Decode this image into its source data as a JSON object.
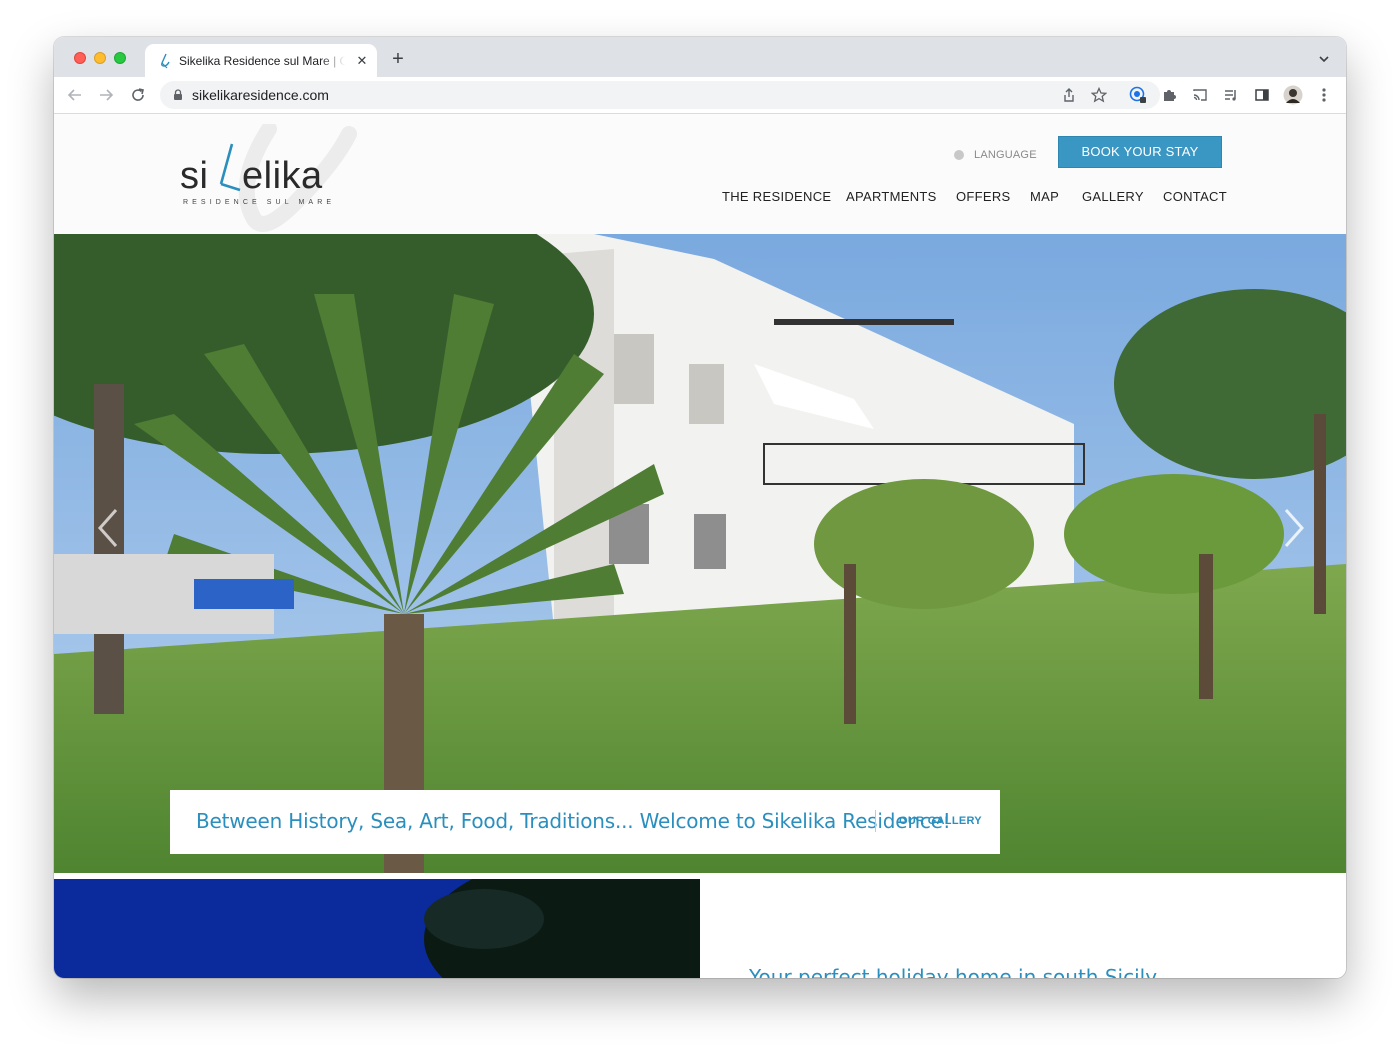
{
  "browser": {
    "tab_title": "Sikelika Residence sul Mare | C",
    "url": "sikelikaresidence.com",
    "new_tab": "+",
    "close_tab": "✕"
  },
  "header": {
    "logo_main": "sikelika",
    "logo_sub": "RESIDENCE SUL MARE",
    "language_label": "LANGUAGE",
    "book_button": "BOOK YOUR STAY",
    "nav": [
      "THE RESIDENCE",
      "APARTMENTS",
      "OFFERS",
      "MAP",
      "GALLERY",
      "CONTACT"
    ]
  },
  "hero": {
    "caption": "Between History, Sea, Art, Food, Traditions... Welcome to Sikelika Residence!",
    "caption_link": "OUR GALLERY"
  },
  "section": {
    "heading": "Your perfect holiday home in south Sicily"
  },
  "colors": {
    "accent": "#2a8fbe",
    "button": "#3a97c4"
  },
  "icons": [
    "back-icon",
    "forward-icon",
    "reload-icon",
    "lock-icon",
    "share-icon",
    "star-icon",
    "extension-icon",
    "cast-icon",
    "reading-list-icon",
    "sidepanel-icon",
    "profile-avatar",
    "kebab-menu-icon",
    "globe-icon",
    "chevron-left-icon",
    "chevron-right-icon"
  ]
}
